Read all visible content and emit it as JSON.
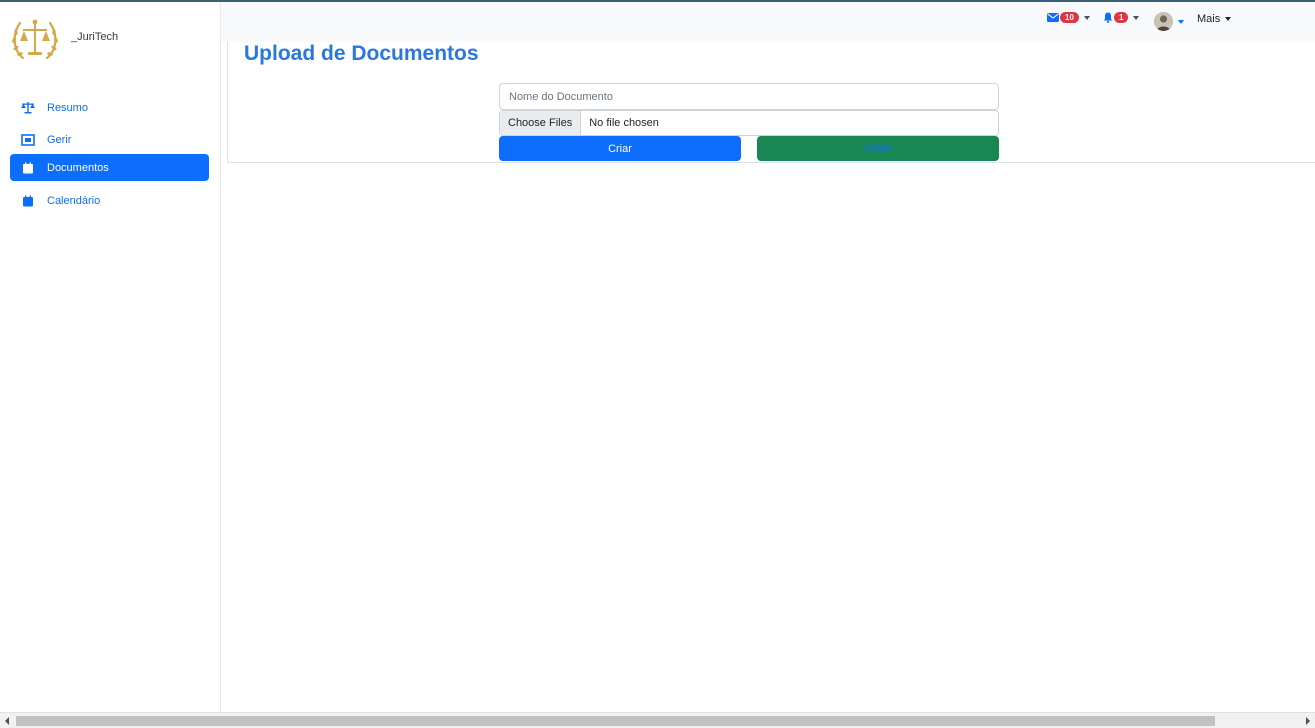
{
  "brand": {
    "name": "_JuriTech",
    "logo_icon": "scales-laurel-logo-icon"
  },
  "sidebar": {
    "items": [
      {
        "label": "Resumo",
        "icon": "scales-icon",
        "active": false
      },
      {
        "label": "Gerir",
        "icon": "manage-icon",
        "active": false
      },
      {
        "label": "Documentos",
        "icon": "calendar-icon",
        "active": true
      },
      {
        "label": "Calendário",
        "icon": "calendar-icon",
        "active": false
      }
    ]
  },
  "topbar": {
    "messages": {
      "icon": "envelope-icon",
      "count": "10"
    },
    "alerts": {
      "icon": "bell-icon",
      "count": "1"
    },
    "user": {
      "icon": "avatar"
    },
    "more_label": "Mais"
  },
  "main": {
    "title": "Upload de Documentos",
    "form": {
      "name_placeholder": "Nome do Documento",
      "name_value": "",
      "file_button_label": "Choose Files",
      "file_status": "No file chosen",
      "create_label": "Criar",
      "back_label": "Voltar"
    }
  },
  "colors": {
    "primary": "#0d6efd",
    "success": "#198754",
    "danger": "#dc3545",
    "title": "#2a77e0",
    "gold": "#d4a84b"
  }
}
